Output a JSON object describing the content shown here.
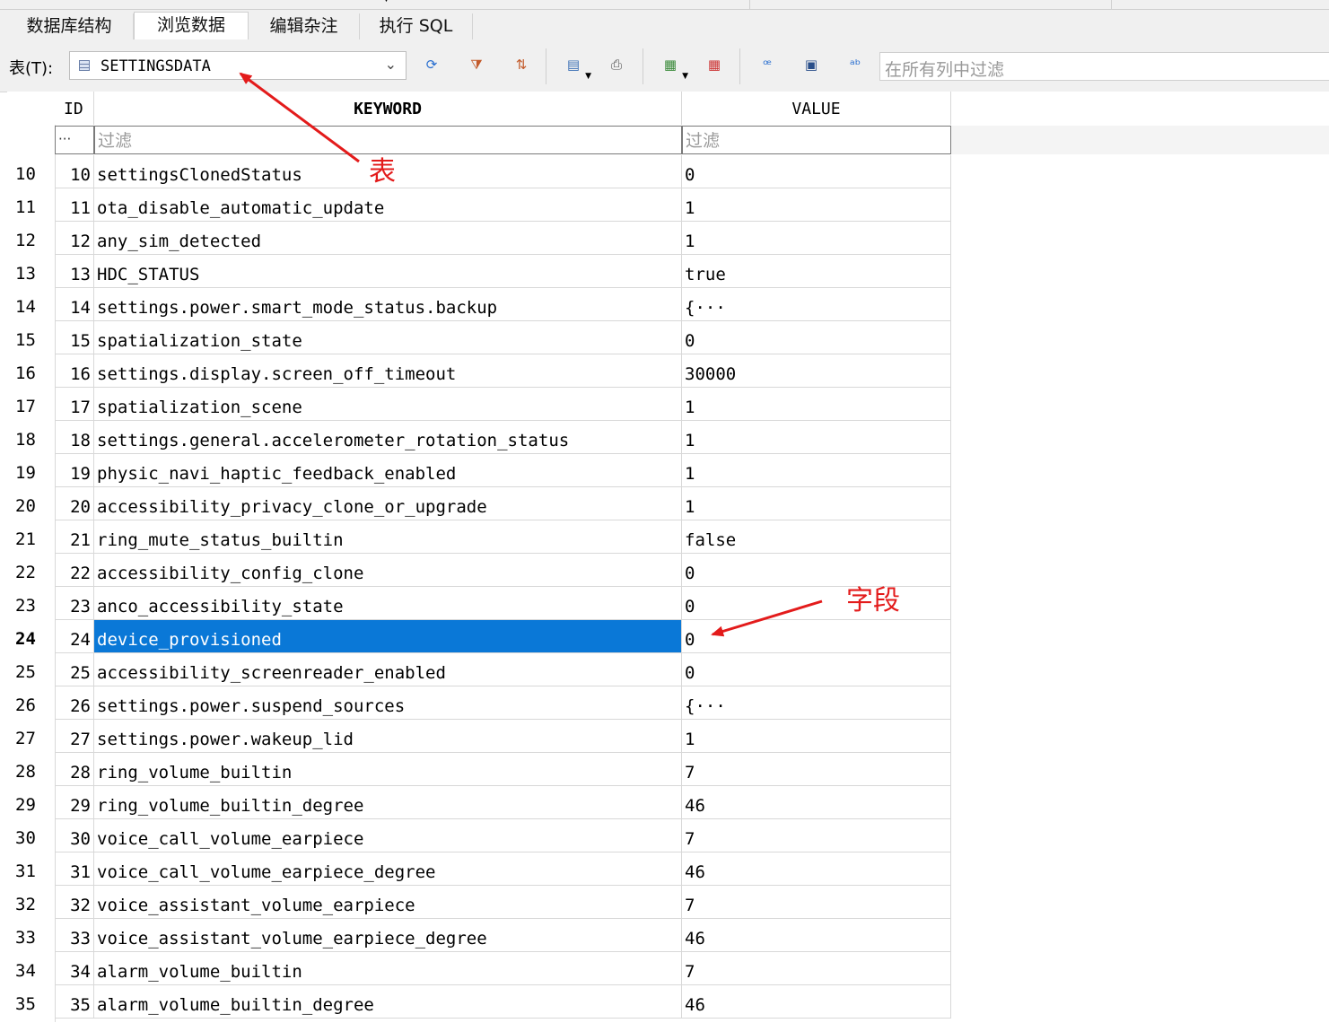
{
  "tabs": [
    {
      "label": "数据库结构",
      "active": false
    },
    {
      "label": "浏览数据",
      "active": true
    },
    {
      "label": "编辑杂注",
      "active": false
    },
    {
      "label": "执行 SQL",
      "active": false
    }
  ],
  "toolbar": {
    "table_label": "表(T):",
    "table_value": "SETTINGSDATA",
    "filter_all_placeholder": "在所有列中过滤",
    "icons": [
      "refresh-icon",
      "clear-filter-icon",
      "clear-sort-icon",
      "save-table-icon",
      "print-icon",
      "insert-record-icon",
      "delete-record-icon",
      "find-icon",
      "replace-icon",
      "set-encoding-icon"
    ]
  },
  "grid": {
    "columns": [
      "ID",
      "KEYWORD",
      "VALUE"
    ],
    "filter_more": "···",
    "filter_placeholder": "过滤",
    "selected_row": 24,
    "rows": [
      {
        "rn": "10",
        "id": "10",
        "keyword": "settingsClonedStatus",
        "value": "0"
      },
      {
        "rn": "11",
        "id": "11",
        "keyword": "ota_disable_automatic_update",
        "value": "1"
      },
      {
        "rn": "12",
        "id": "12",
        "keyword": "any_sim_detected",
        "value": "1"
      },
      {
        "rn": "13",
        "id": "13",
        "keyword": "HDC_STATUS",
        "value": "true"
      },
      {
        "rn": "14",
        "id": "14",
        "keyword": "settings.power.smart_mode_status.backup",
        "value": "{···"
      },
      {
        "rn": "15",
        "id": "15",
        "keyword": "spatialization_state",
        "value": "0"
      },
      {
        "rn": "16",
        "id": "16",
        "keyword": "settings.display.screen_off_timeout",
        "value": "30000"
      },
      {
        "rn": "17",
        "id": "17",
        "keyword": "spatialization_scene",
        "value": "1"
      },
      {
        "rn": "18",
        "id": "18",
        "keyword": "settings.general.accelerometer_rotation_status",
        "value": "1"
      },
      {
        "rn": "19",
        "id": "19",
        "keyword": "physic_navi_haptic_feedback_enabled",
        "value": "1"
      },
      {
        "rn": "20",
        "id": "20",
        "keyword": "accessibility_privacy_clone_or_upgrade",
        "value": "1"
      },
      {
        "rn": "21",
        "id": "21",
        "keyword": "ring_mute_status_builtin",
        "value": "false"
      },
      {
        "rn": "22",
        "id": "22",
        "keyword": "accessibility_config_clone",
        "value": "0"
      },
      {
        "rn": "23",
        "id": "23",
        "keyword": "anco_accessibility_state",
        "value": "0"
      },
      {
        "rn": "24",
        "id": "24",
        "keyword": "device_provisioned",
        "value": "0"
      },
      {
        "rn": "25",
        "id": "25",
        "keyword": "accessibility_screenreader_enabled",
        "value": "0"
      },
      {
        "rn": "26",
        "id": "26",
        "keyword": "settings.power.suspend_sources",
        "value": "{···"
      },
      {
        "rn": "27",
        "id": "27",
        "keyword": "settings.power.wakeup_lid",
        "value": "1"
      },
      {
        "rn": "28",
        "id": "28",
        "keyword": "ring_volume_builtin",
        "value": "7"
      },
      {
        "rn": "29",
        "id": "29",
        "keyword": "ring_volume_builtin_degree",
        "value": "46"
      },
      {
        "rn": "30",
        "id": "30",
        "keyword": "voice_call_volume_earpiece",
        "value": "7"
      },
      {
        "rn": "31",
        "id": "31",
        "keyword": "voice_call_volume_earpiece_degree",
        "value": "46"
      },
      {
        "rn": "32",
        "id": "32",
        "keyword": "voice_assistant_volume_earpiece",
        "value": "7"
      },
      {
        "rn": "33",
        "id": "33",
        "keyword": "voice_assistant_volume_earpiece_degree",
        "value": "46"
      },
      {
        "rn": "34",
        "id": "34",
        "keyword": "alarm_volume_builtin",
        "value": "7"
      },
      {
        "rn": "35",
        "id": "35",
        "keyword": "alarm_volume_builtin_degree",
        "value": "46"
      }
    ]
  },
  "annotations": {
    "table_label": "表",
    "field_label": "字段",
    "color": "#e31b1b"
  },
  "colors": {
    "selection": "#0a78d7"
  }
}
